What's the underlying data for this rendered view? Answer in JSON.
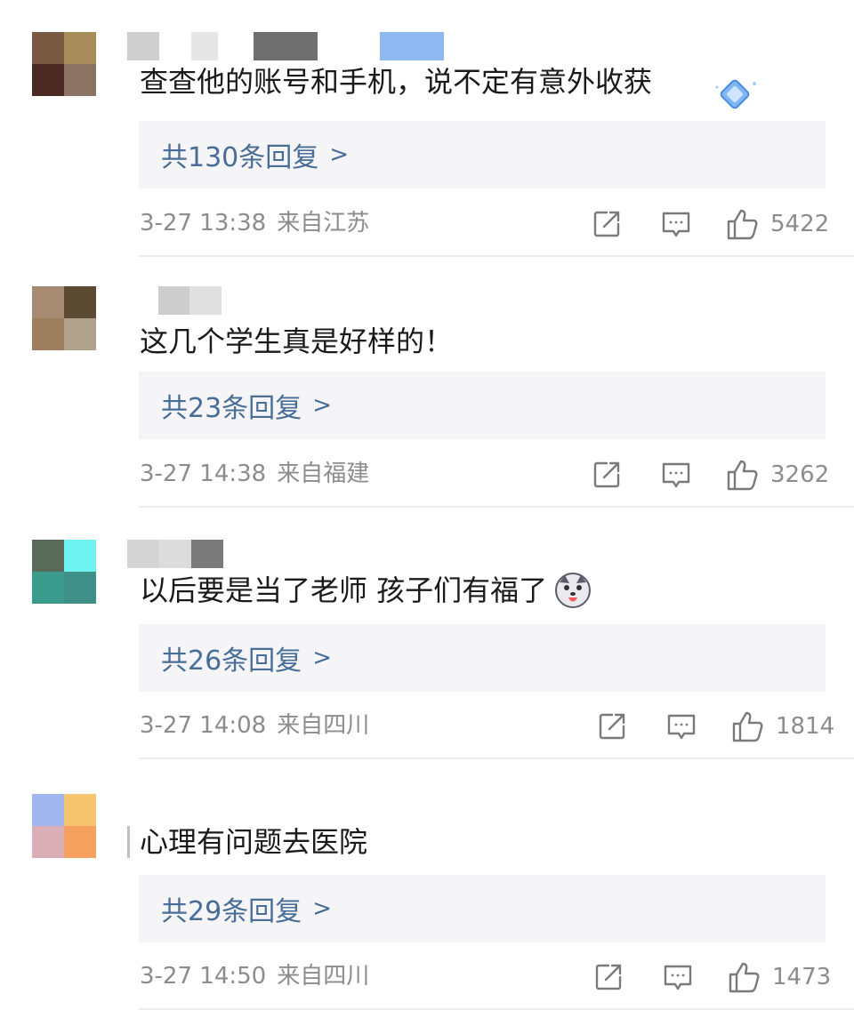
{
  "comments": [
    {
      "text": "查查他的账号和手机，说不定有意外收获",
      "reply_count_label": "共130条回复",
      "time": "3-27 13:38",
      "location": "来自江苏",
      "likes": "5422"
    },
    {
      "text": "这几个学生真是好样的！",
      "reply_count_label": "共23条回复",
      "time": "3-27 14:38",
      "location": "来自福建",
      "likes": "3262"
    },
    {
      "text": "以后要是当了老师 孩子们有福了",
      "reply_count_label": "共26条回复",
      "time": "3-27 14:08",
      "location": "来自四川",
      "likes": "1814"
    },
    {
      "text": "心理有问题去医院",
      "reply_count_label": "共29条回复",
      "time": "3-27 14:50",
      "location": "来自四川",
      "likes": "1473"
    }
  ],
  "chevron": ">",
  "icons": {
    "share": "share-icon",
    "comment": "comment-icon",
    "like": "thumbs-up-icon",
    "emoji": "husky-emoji-icon",
    "badge": "diamond-badge-icon"
  },
  "colors": {
    "reply_link": "#486d96",
    "meta_text": "#8c8c8c",
    "reply_bg": "#f5f5f7"
  }
}
